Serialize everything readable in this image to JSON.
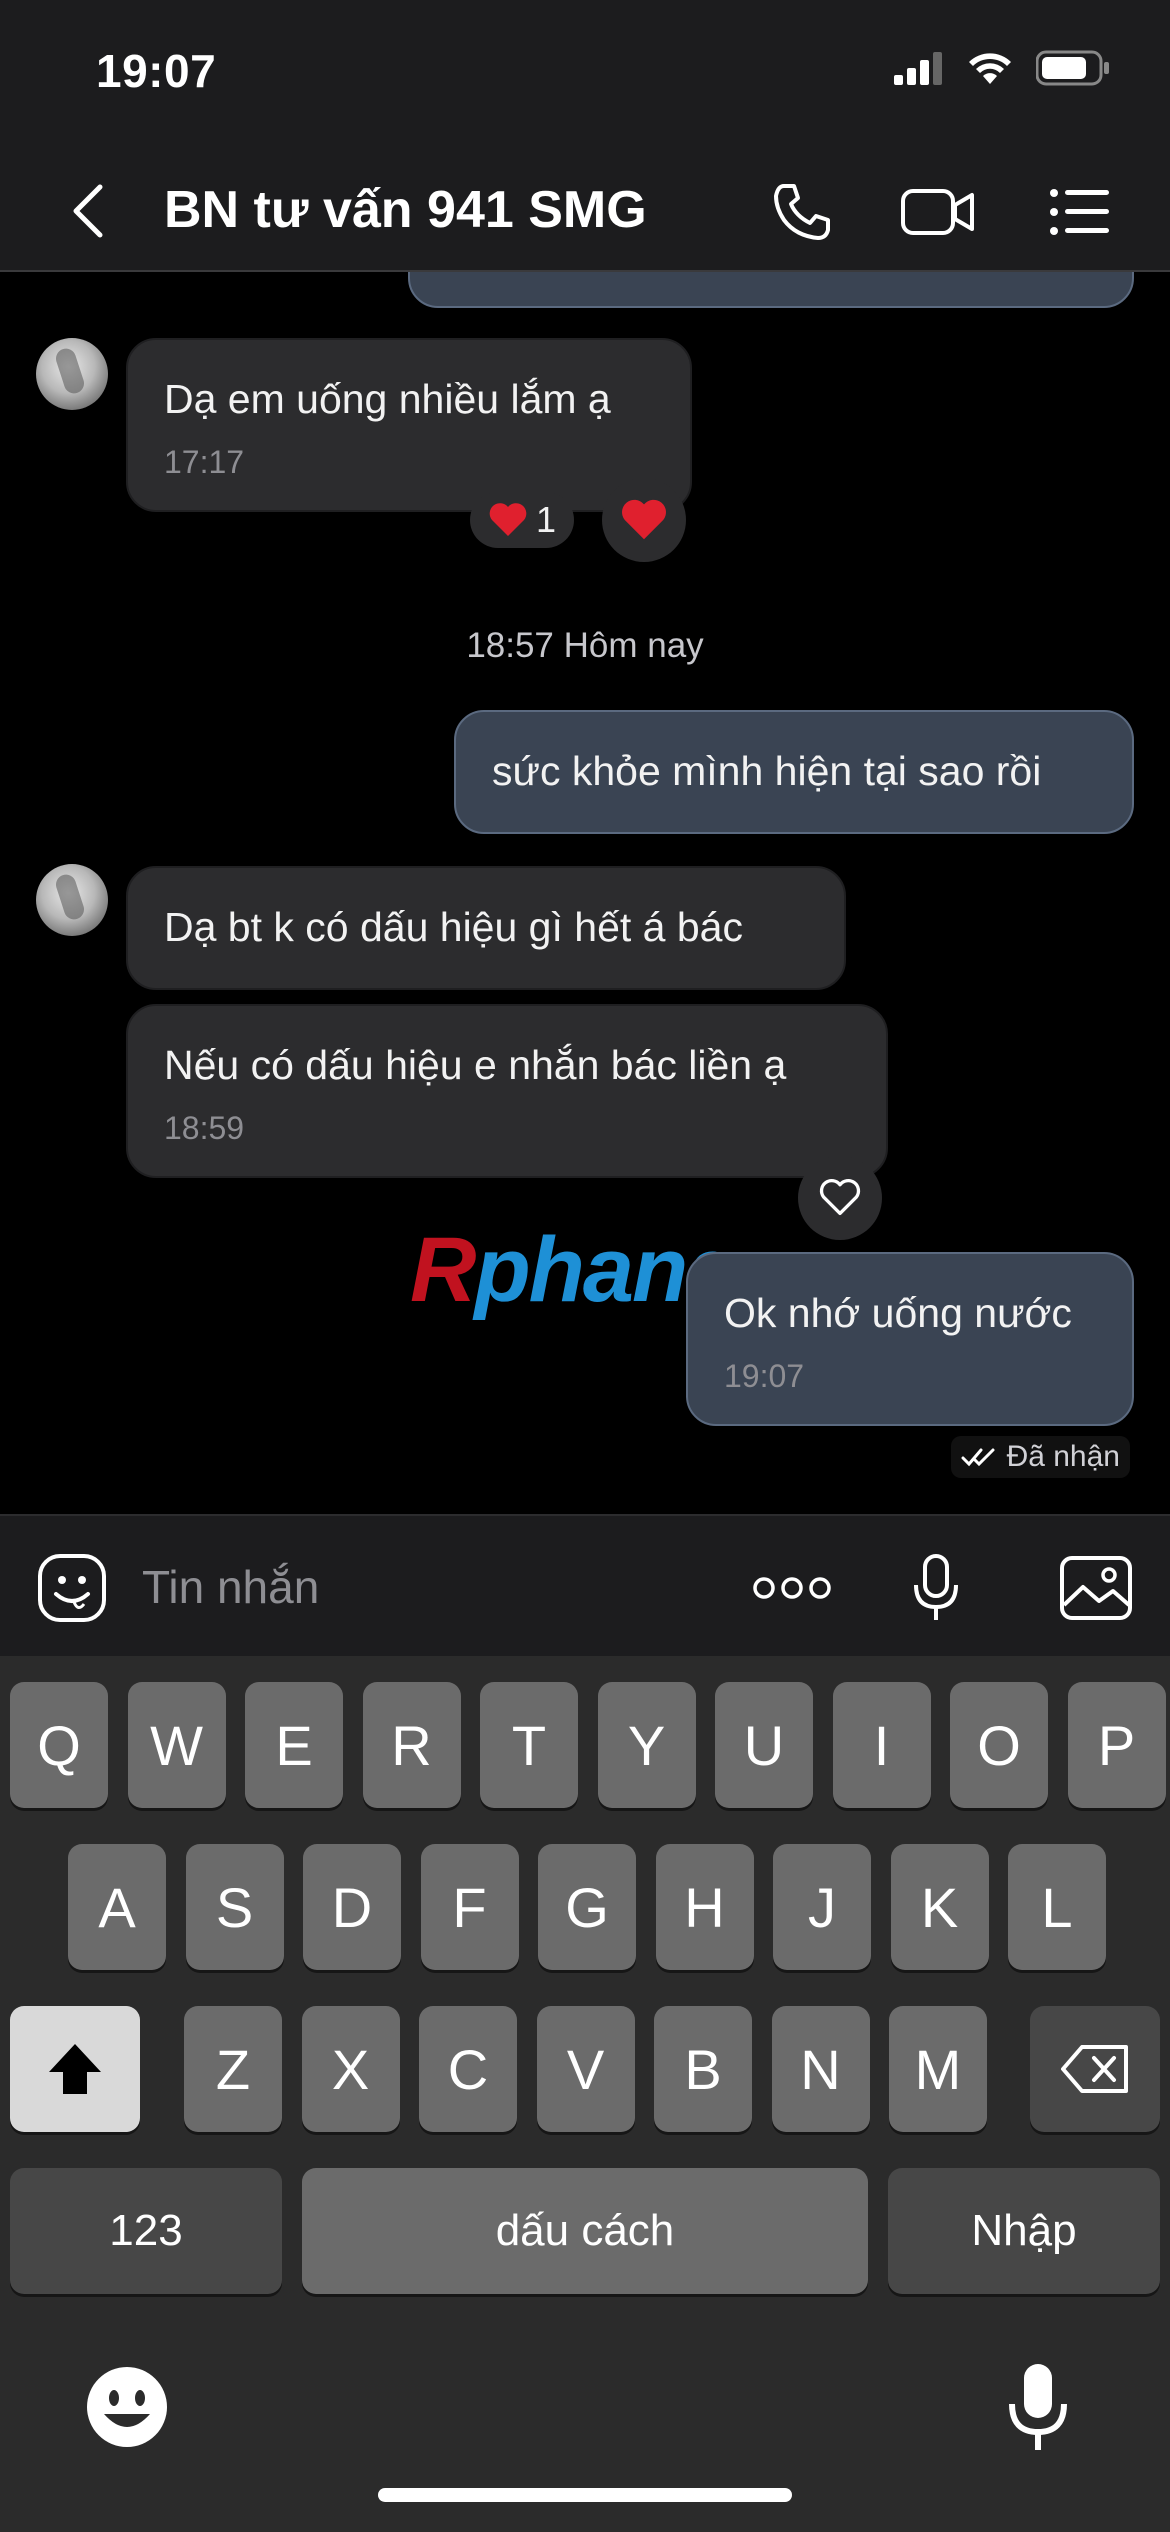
{
  "status_bar": {
    "time": "19:07"
  },
  "header": {
    "title": "BN tư vấn 941 SMG"
  },
  "messages": [
    {
      "text": "Dạ em uống nhiều lắm ạ",
      "time": "17:17",
      "reaction_count": "1"
    },
    {
      "separator": "18:57 Hôm nay"
    },
    {
      "text": "sức khỏe mình hiện tại sao rồi"
    },
    {
      "text": "Dạ bt k có dấu hiệu gì hết á bác"
    },
    {
      "text": "Nếu có dấu hiệu e nhắn bác liền ạ",
      "time": "18:59"
    },
    {
      "text": "Ok nhớ uống nước",
      "time": "19:07"
    }
  ],
  "received_status": "Đã nhận",
  "watermark": {
    "first": "R",
    "rest": "phang"
  },
  "input": {
    "placeholder": "Tin nhắn"
  },
  "keyboard": {
    "row1": [
      "Q",
      "W",
      "E",
      "R",
      "T",
      "Y",
      "U",
      "I",
      "O",
      "P"
    ],
    "row2": [
      "A",
      "S",
      "D",
      "F",
      "G",
      "H",
      "J",
      "K",
      "L"
    ],
    "row3": [
      "Z",
      "X",
      "C",
      "V",
      "B",
      "N",
      "M"
    ],
    "numbers": "123",
    "space": "dấu cách",
    "enter": "Nhập"
  },
  "colors": {
    "incoming_bubble": "#2c2c2e",
    "outgoing_bubble": "#3a4453",
    "heart": "#e0202e"
  },
  "icons": [
    "back-icon",
    "phone-icon",
    "video-icon",
    "menu-list-icon",
    "emoji-sticker-icon",
    "more-dots-icon",
    "microphone-icon",
    "image-icon",
    "heart-icon",
    "double-check-icon",
    "shift-icon",
    "backspace-icon",
    "emoji-icon"
  ]
}
